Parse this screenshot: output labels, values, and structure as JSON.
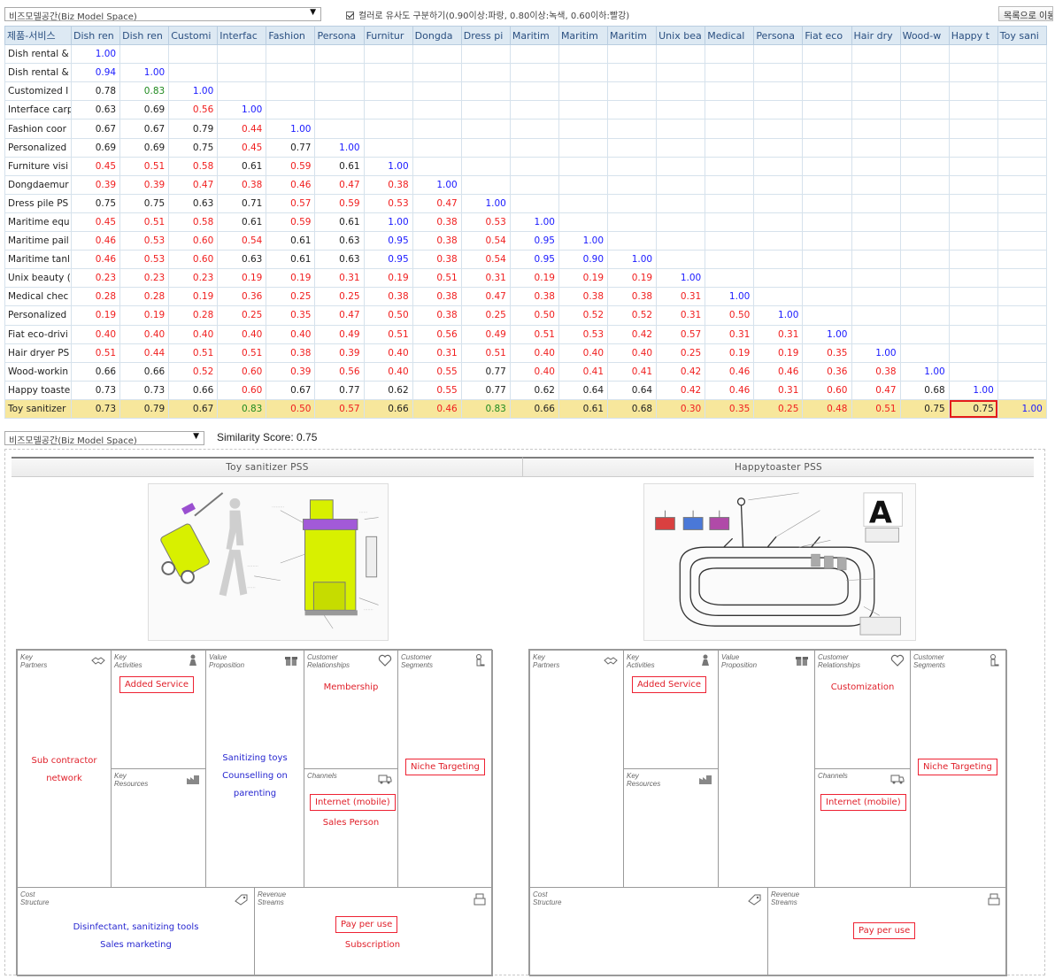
{
  "toolbar": {
    "space_select": "비즈모델공간(Biz Model Space)",
    "color_checkbox_label": "컬러로 유사도 구분하기(0.90이상:파랑, 0.80이상:녹색, 0.60이하:빨강)",
    "list_button": "목록으로 이동"
  },
  "matrix": {
    "corner_header": "제품-서비스",
    "columns": [
      "Dish ren",
      "Dish ren",
      "Customi",
      "Interfac",
      "Fashion",
      "Persona",
      "Furnitur",
      "Dongda",
      "Dress pi",
      "Maritim",
      "Maritim",
      "Maritim",
      "Unix bea",
      "Medical",
      "Persona",
      "Fiat eco",
      "Hair dry",
      "Wood-w",
      "Happy t",
      "Toy sani"
    ],
    "rows": [
      {
        "name": "Dish rental &",
        "values": [
          "1.00"
        ],
        "colors": [
          "blue"
        ]
      },
      {
        "name": "Dish rental &",
        "values": [
          "0.94",
          "1.00"
        ],
        "colors": [
          "blue",
          "blue"
        ]
      },
      {
        "name": "Customized I",
        "values": [
          "0.78",
          "0.83",
          "1.00"
        ],
        "colors": [
          "black",
          "green",
          "blue"
        ]
      },
      {
        "name": "Interface carp",
        "values": [
          "0.63",
          "0.69",
          "0.56",
          "1.00"
        ],
        "colors": [
          "black",
          "black",
          "red",
          "blue"
        ]
      },
      {
        "name": "Fashion coor",
        "values": [
          "0.67",
          "0.67",
          "0.79",
          "0.44",
          "1.00"
        ],
        "colors": [
          "black",
          "black",
          "black",
          "red",
          "blue"
        ]
      },
      {
        "name": "Personalized",
        "values": [
          "0.69",
          "0.69",
          "0.75",
          "0.45",
          "0.77",
          "1.00"
        ],
        "colors": [
          "black",
          "black",
          "black",
          "red",
          "black",
          "blue"
        ]
      },
      {
        "name": "Furniture visi",
        "values": [
          "0.45",
          "0.51",
          "0.58",
          "0.61",
          "0.59",
          "0.61",
          "1.00"
        ],
        "colors": [
          "red",
          "red",
          "red",
          "black",
          "red",
          "black",
          "blue"
        ]
      },
      {
        "name": "Dongdaemur",
        "values": [
          "0.39",
          "0.39",
          "0.47",
          "0.38",
          "0.46",
          "0.47",
          "0.38",
          "1.00"
        ],
        "colors": [
          "red",
          "red",
          "red",
          "red",
          "red",
          "red",
          "red",
          "blue"
        ]
      },
      {
        "name": "Dress pile PS",
        "values": [
          "0.75",
          "0.75",
          "0.63",
          "0.71",
          "0.57",
          "0.59",
          "0.53",
          "0.47",
          "1.00"
        ],
        "colors": [
          "black",
          "black",
          "black",
          "black",
          "red",
          "red",
          "red",
          "red",
          "blue"
        ]
      },
      {
        "name": "Maritime equ",
        "values": [
          "0.45",
          "0.51",
          "0.58",
          "0.61",
          "0.59",
          "0.61",
          "1.00",
          "0.38",
          "0.53",
          "1.00"
        ],
        "colors": [
          "red",
          "red",
          "red",
          "black",
          "red",
          "black",
          "blue",
          "red",
          "red",
          "blue"
        ]
      },
      {
        "name": "Maritime pail",
        "values": [
          "0.46",
          "0.53",
          "0.60",
          "0.54",
          "0.61",
          "0.63",
          "0.95",
          "0.38",
          "0.54",
          "0.95",
          "1.00"
        ],
        "colors": [
          "red",
          "red",
          "red",
          "red",
          "black",
          "black",
          "blue",
          "red",
          "red",
          "blue",
          "blue"
        ]
      },
      {
        "name": "Maritime tanl",
        "values": [
          "0.46",
          "0.53",
          "0.60",
          "0.63",
          "0.61",
          "0.63",
          "0.95",
          "0.38",
          "0.54",
          "0.95",
          "0.90",
          "1.00"
        ],
        "colors": [
          "red",
          "red",
          "red",
          "black",
          "black",
          "black",
          "blue",
          "red",
          "red",
          "blue",
          "blue",
          "blue"
        ]
      },
      {
        "name": "Unix beauty (",
        "values": [
          "0.23",
          "0.23",
          "0.23",
          "0.19",
          "0.19",
          "0.31",
          "0.19",
          "0.51",
          "0.31",
          "0.19",
          "0.19",
          "0.19",
          "1.00"
        ],
        "colors": [
          "red",
          "red",
          "red",
          "red",
          "red",
          "red",
          "red",
          "red",
          "red",
          "red",
          "red",
          "red",
          "blue"
        ]
      },
      {
        "name": "Medical chec",
        "values": [
          "0.28",
          "0.28",
          "0.19",
          "0.36",
          "0.25",
          "0.25",
          "0.38",
          "0.38",
          "0.47",
          "0.38",
          "0.38",
          "0.38",
          "0.31",
          "1.00"
        ],
        "colors": [
          "red",
          "red",
          "red",
          "red",
          "red",
          "red",
          "red",
          "red",
          "red",
          "red",
          "red",
          "red",
          "red",
          "blue"
        ]
      },
      {
        "name": "Personalized",
        "values": [
          "0.19",
          "0.19",
          "0.28",
          "0.25",
          "0.35",
          "0.47",
          "0.50",
          "0.38",
          "0.25",
          "0.50",
          "0.52",
          "0.52",
          "0.31",
          "0.50",
          "1.00"
        ],
        "colors": [
          "red",
          "red",
          "red",
          "red",
          "red",
          "red",
          "red",
          "red",
          "red",
          "red",
          "red",
          "red",
          "red",
          "red",
          "blue"
        ]
      },
      {
        "name": "Fiat eco-drivi",
        "values": [
          "0.40",
          "0.40",
          "0.40",
          "0.40",
          "0.40",
          "0.49",
          "0.51",
          "0.56",
          "0.49",
          "0.51",
          "0.53",
          "0.42",
          "0.57",
          "0.31",
          "0.31",
          "1.00"
        ],
        "colors": [
          "red",
          "red",
          "red",
          "red",
          "red",
          "red",
          "red",
          "red",
          "red",
          "red",
          "red",
          "red",
          "red",
          "red",
          "red",
          "blue"
        ]
      },
      {
        "name": "Hair dryer PS",
        "values": [
          "0.51",
          "0.44",
          "0.51",
          "0.51",
          "0.38",
          "0.39",
          "0.40",
          "0.31",
          "0.51",
          "0.40",
          "0.40",
          "0.40",
          "0.25",
          "0.19",
          "0.19",
          "0.35",
          "1.00"
        ],
        "colors": [
          "red",
          "red",
          "red",
          "red",
          "red",
          "red",
          "red",
          "red",
          "red",
          "red",
          "red",
          "red",
          "red",
          "red",
          "red",
          "red",
          "blue"
        ]
      },
      {
        "name": "Wood-workin",
        "values": [
          "0.66",
          "0.66",
          "0.52",
          "0.60",
          "0.39",
          "0.56",
          "0.40",
          "0.55",
          "0.77",
          "0.40",
          "0.41",
          "0.41",
          "0.42",
          "0.46",
          "0.46",
          "0.36",
          "0.38",
          "1.00"
        ],
        "colors": [
          "black",
          "black",
          "red",
          "red",
          "red",
          "red",
          "red",
          "red",
          "black",
          "red",
          "red",
          "red",
          "red",
          "red",
          "red",
          "red",
          "red",
          "blue"
        ]
      },
      {
        "name": "Happy toaste",
        "values": [
          "0.73",
          "0.73",
          "0.66",
          "0.60",
          "0.67",
          "0.77",
          "0.62",
          "0.55",
          "0.77",
          "0.62",
          "0.64",
          "0.64",
          "0.42",
          "0.46",
          "0.31",
          "0.60",
          "0.47",
          "0.68",
          "1.00"
        ],
        "colors": [
          "black",
          "black",
          "black",
          "red",
          "black",
          "black",
          "black",
          "red",
          "black",
          "black",
          "black",
          "black",
          "red",
          "red",
          "red",
          "red",
          "red",
          "black",
          "blue"
        ]
      },
      {
        "name": "Toy sanitizer",
        "values": [
          "0.73",
          "0.79",
          "0.67",
          "0.83",
          "0.50",
          "0.57",
          "0.66",
          "0.46",
          "0.83",
          "0.66",
          "0.61",
          "0.68",
          "0.30",
          "0.35",
          "0.25",
          "0.48",
          "0.51",
          "0.75",
          "0.75",
          "1.00"
        ],
        "colors": [
          "black",
          "black",
          "black",
          "green",
          "red",
          "red",
          "black",
          "red",
          "green",
          "black",
          "black",
          "black",
          "red",
          "red",
          "red",
          "red",
          "red",
          "black",
          "black",
          "blue"
        ],
        "selected": true
      }
    ],
    "highlight": {
      "row": 19,
      "col": 18
    }
  },
  "compare": {
    "space_select": "비즈모델공간(Biz Model Space)",
    "similarity_label": "Similarity Score: 0.75",
    "left": {
      "title": "Toy sanitizer PSS",
      "image_icon": "toy-sanitizer-sketch",
      "canvas": {
        "key_partners_label": "Key\nPartners",
        "key_activities_label": "Key\nActivities",
        "value_proposition_label": "Value\nProposition",
        "customer_relationships_label": "Customer\nRelationships",
        "customer_segments_label": "Customer\nSegments",
        "key_resources_label": "Key\nResources",
        "channels_label": "Channels",
        "cost_structure_label": "Cost\nStructure",
        "revenue_streams_label": "Revenue\nStreams",
        "partners_line1": "Sub contractor",
        "partners_line2": "network",
        "activities_tag": "Added Service",
        "value_line1": "Sanitizing toys",
        "value_line2": "Counselling on",
        "value_line3": "parenting",
        "relationships_text": "Membership",
        "segments_tag": "Niche Targeting",
        "channels_tag": "Internet (mobile)",
        "channels_text": "Sales Person",
        "cost_line1": "Disinfectant, sanitizing tools",
        "cost_line2": "Sales marketing",
        "revenue_tag": "Pay per use",
        "revenue_text": "Subscription"
      }
    },
    "right": {
      "title": "Happytoaster PSS",
      "image_icon": "happy-toaster-sketch",
      "canvas": {
        "key_partners_label": "Key\nPartners",
        "key_activities_label": "Key\nActivities",
        "value_proposition_label": "Value\nProposition",
        "customer_relationships_label": "Customer\nRelationships",
        "customer_segments_label": "Customer\nSegments",
        "key_resources_label": "Key\nResources",
        "channels_label": "Channels",
        "cost_structure_label": "Cost\nStructure",
        "revenue_streams_label": "Revenue\nStreams",
        "activities_tag": "Added Service",
        "relationships_text": "Customization",
        "segments_tag": "Niche Targeting",
        "channels_tag": "Internet (mobile)",
        "revenue_tag": "Pay per use"
      }
    }
  },
  "colors": {
    "blue": "#1a1aff",
    "green": "#1f8a1f",
    "red": "#f01e1e",
    "selected_row": "#f7e79c",
    "highlight": "#e41c1c",
    "accent_lime": "#d8f000",
    "accent_purple": "#9a4fd0"
  }
}
